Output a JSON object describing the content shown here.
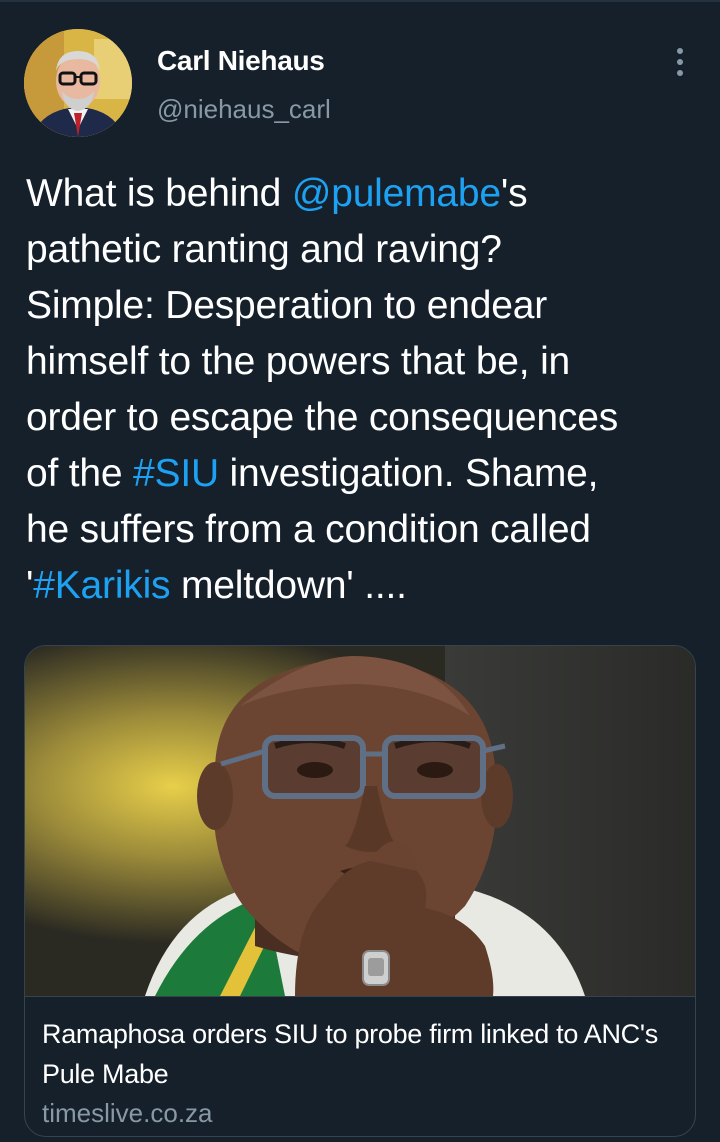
{
  "colors": {
    "background": "#15202b",
    "link": "#1da1f2",
    "secondary_text": "#8899a6",
    "border": "#38444d"
  },
  "author": {
    "display_name": "Carl Niehaus",
    "handle": "@niehaus_carl",
    "avatar_icon": "profile-photo"
  },
  "menu": {
    "icon": "more-vertical-icon"
  },
  "tweet": {
    "lines": [
      [
        {
          "text": "What is behind ",
          "type": "text"
        },
        {
          "text": "@pulemabe",
          "type": "mention"
        },
        {
          "text": "'s",
          "type": "text"
        }
      ],
      [
        {
          "text": "pathetic ranting and raving?",
          "type": "text"
        }
      ],
      [
        {
          "text": "Simple: Desperation to endear",
          "type": "text"
        }
      ],
      [
        {
          "text": "himself to the powers that be, in",
          "type": "text"
        }
      ],
      [
        {
          "text": "order to escape the consequences",
          "type": "text"
        }
      ],
      [
        {
          "text": "of the ",
          "type": "text"
        },
        {
          "text": "#SIU",
          "type": "hashtag"
        },
        {
          "text": " investigation. Shame,",
          "type": "text"
        }
      ],
      [
        {
          "text": "he suffers from a condition called",
          "type": "text"
        }
      ],
      [
        {
          "text": "'",
          "type": "text"
        },
        {
          "text": "#Karikis",
          "type": "hashtag"
        },
        {
          "text": " meltdown' ....",
          "type": "text"
        }
      ]
    ]
  },
  "link_card": {
    "title": "Ramaphosa orders SIU to probe firm linked to ANC's Pule Mabe",
    "domain": "timeslive.co.za"
  }
}
